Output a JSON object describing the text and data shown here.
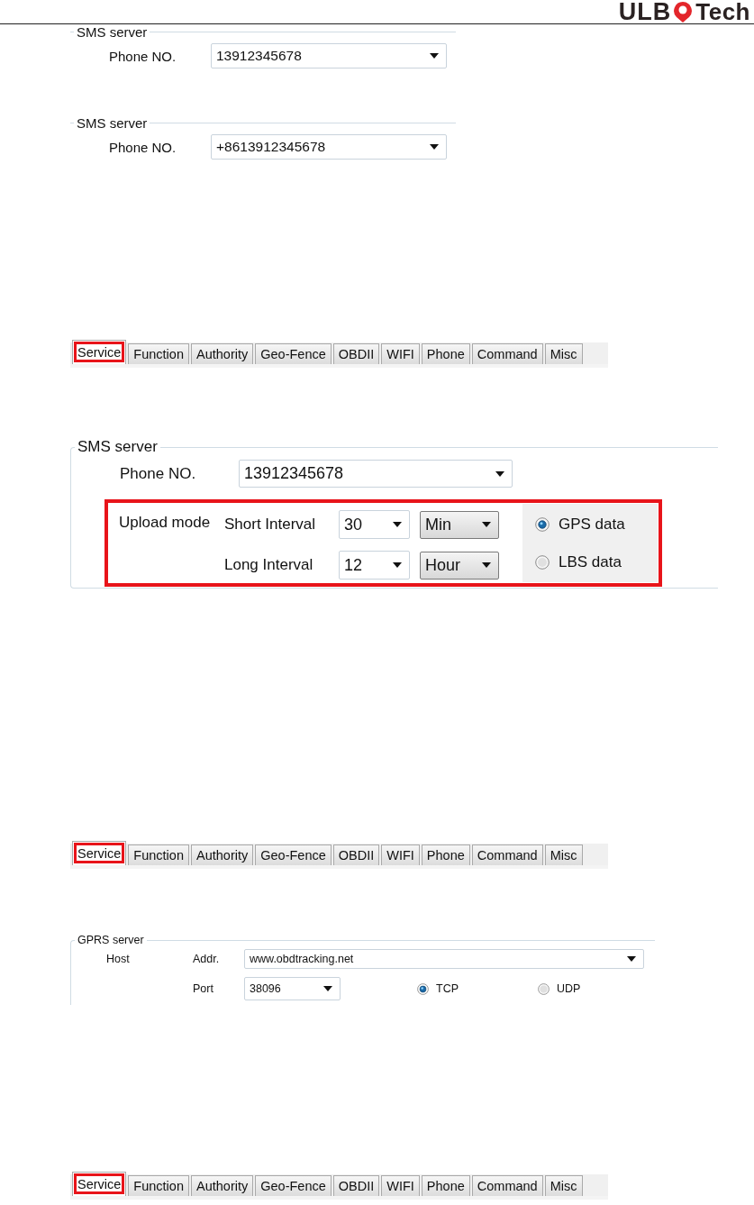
{
  "header": {
    "logo_left": "ULB",
    "logo_right": "Tech"
  },
  "blocks": [
    {
      "kind": "sms",
      "legend": "SMS server",
      "label": "Phone NO.",
      "value": "13912345678"
    },
    {
      "kind": "sms",
      "legend": "SMS server",
      "label": "Phone NO.",
      "value": "+8613912345678"
    },
    {
      "kind": "tabs",
      "tabs": [
        {
          "label": "Service",
          "selected": true,
          "highlighted": true
        },
        {
          "label": "Function",
          "selected": false,
          "highlighted": false
        },
        {
          "label": "Authority",
          "selected": false,
          "highlighted": false
        },
        {
          "label": "Geo-Fence",
          "selected": false,
          "highlighted": false
        },
        {
          "label": "OBDII",
          "selected": false,
          "highlighted": false
        },
        {
          "label": "WIFI",
          "selected": false,
          "highlighted": false
        },
        {
          "label": "Phone",
          "selected": false,
          "highlighted": false
        },
        {
          "label": "Command",
          "selected": false,
          "highlighted": false
        },
        {
          "label": "Misc",
          "selected": false,
          "highlighted": false
        }
      ]
    },
    {
      "kind": "sms_upload",
      "legend": "SMS server",
      "label": "Phone NO.",
      "value": "13912345678",
      "upload_label": "Upload mode",
      "highlighted": true,
      "intervals": [
        {
          "label": "Short Interval",
          "value": "30",
          "unit": "Min"
        },
        {
          "label": "Long Interval",
          "value": "12",
          "unit": "Hour"
        }
      ],
      "radios": [
        {
          "label": "GPS data",
          "selected": true
        },
        {
          "label": "LBS data",
          "selected": false
        }
      ]
    },
    {
      "kind": "tabs",
      "tabs": [
        {
          "label": "Service",
          "selected": true,
          "highlighted": true
        },
        {
          "label": "Function",
          "selected": false,
          "highlighted": false
        },
        {
          "label": "Authority",
          "selected": false,
          "highlighted": false
        },
        {
          "label": "Geo-Fence",
          "selected": false,
          "highlighted": false
        },
        {
          "label": "OBDII",
          "selected": false,
          "highlighted": false
        },
        {
          "label": "WIFI",
          "selected": false,
          "highlighted": false
        },
        {
          "label": "Phone",
          "selected": false,
          "highlighted": false
        },
        {
          "label": "Command",
          "selected": false,
          "highlighted": false
        },
        {
          "label": "Misc",
          "selected": false,
          "highlighted": false
        }
      ]
    },
    {
      "kind": "gprs",
      "legend": "GPRS server",
      "host_label": "Host",
      "addr_label": "Addr.",
      "addr": "www.obdtracking.net",
      "port_label": "Port",
      "port": "38096",
      "radios": [
        {
          "label": "TCP",
          "selected": true
        },
        {
          "label": "UDP",
          "selected": false
        }
      ]
    },
    {
      "kind": "tabs",
      "tabs": [
        {
          "label": "Service",
          "selected": true,
          "highlighted": true
        },
        {
          "label": "Function",
          "selected": false,
          "highlighted": false
        },
        {
          "label": "Authority",
          "selected": false,
          "highlighted": false
        },
        {
          "label": "Geo-Fence",
          "selected": false,
          "highlighted": false
        },
        {
          "label": "OBDII",
          "selected": false,
          "highlighted": false
        },
        {
          "label": "WIFI",
          "selected": false,
          "highlighted": false
        },
        {
          "label": "Phone",
          "selected": false,
          "highlighted": false
        },
        {
          "label": "Command",
          "selected": false,
          "highlighted": false
        },
        {
          "label": "Misc",
          "selected": false,
          "highlighted": false
        }
      ]
    }
  ]
}
